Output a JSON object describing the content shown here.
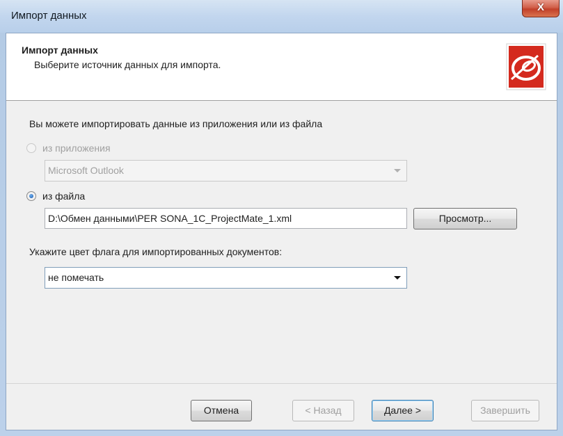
{
  "window": {
    "title": "Импорт данных",
    "close_label": "X"
  },
  "header": {
    "title": "Импорт данных",
    "subtitle": "Выберите источник данных для импорта.",
    "logo_icon": "app-logo-icon",
    "logo_color": "#cc2222"
  },
  "body": {
    "hint": "Вы можете импортировать данные из приложения или из файла",
    "radio_app": {
      "label": "из приложения",
      "checked": false,
      "enabled": false
    },
    "app_select": {
      "value": "Microsoft Outlook",
      "enabled": false
    },
    "radio_file": {
      "label": "из файла",
      "checked": true,
      "enabled": true
    },
    "file_path": {
      "value": "D:\\Обмен данными\\PER SONA_1C_ProjectMate_1.xml"
    },
    "browse_button": "Просмотр...",
    "flag_label": "Укажите цвет флага для импортированных документов:",
    "flag_select": {
      "value": "не помечать"
    }
  },
  "footer": {
    "cancel": "Отмена",
    "back": "< Назад",
    "next": "Далее >",
    "finish": "Завершить"
  }
}
